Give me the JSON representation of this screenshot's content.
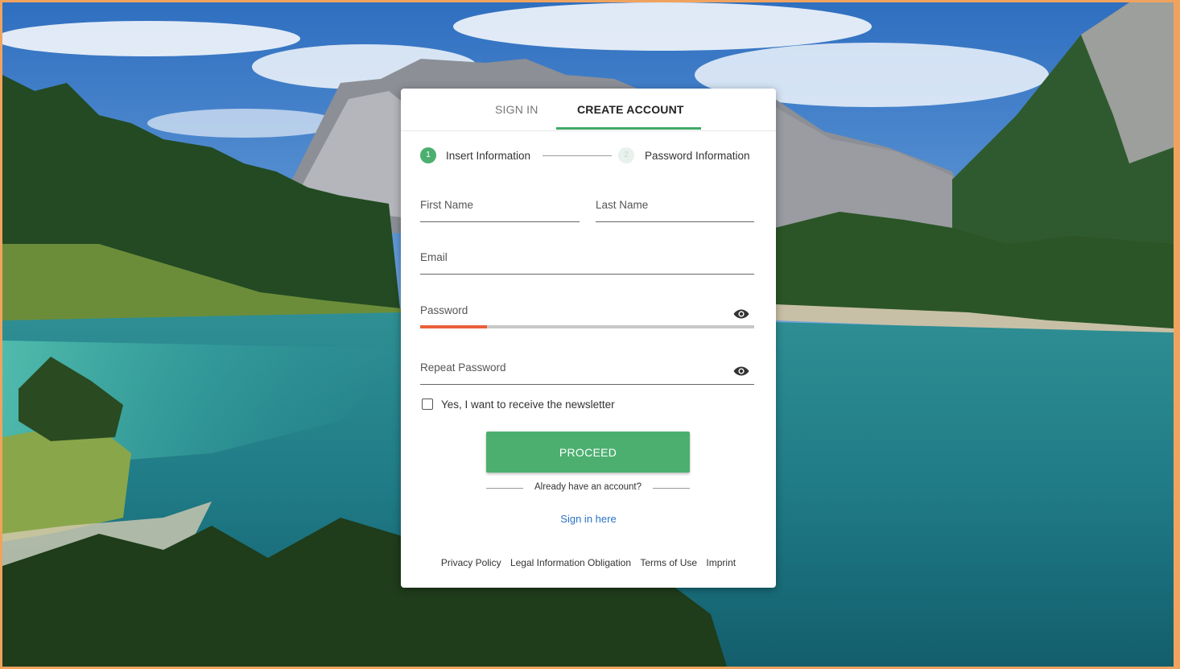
{
  "tabs": {
    "sign_in": "SIGN IN",
    "create_account": "CREATE ACCOUNT"
  },
  "stepper": {
    "step1_number": "1",
    "step1_label": "Insert Information",
    "step2_number": "2",
    "step2_label": "Password Information"
  },
  "form": {
    "first_name_label": "First Name",
    "last_name_label": "Last Name",
    "email_label": "Email",
    "password_label": "Password",
    "password_strength": 0.2,
    "repeat_password_label": "Repeat Password",
    "newsletter_label": "Yes, I want to receive the newsletter",
    "newsletter_checked": false,
    "proceed_label": "PROCEED"
  },
  "account_prompt": {
    "text": "Already have an account?",
    "link": "Sign in here"
  },
  "footer": {
    "links": [
      "Privacy Policy",
      "Legal Information Obligation",
      "Terms of Use",
      "Imprint"
    ]
  },
  "colors": {
    "accent": "#4caf70",
    "strength_weak": "#e9603b",
    "link": "#2a73c4",
    "frame": "#f0a35e"
  }
}
